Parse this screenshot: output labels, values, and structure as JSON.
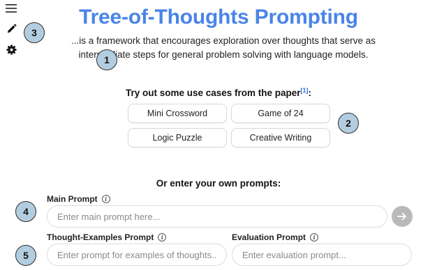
{
  "sidebar": {
    "icons": [
      "menu-icon",
      "pencil-icon",
      "gear-icon"
    ]
  },
  "header": {
    "title": "Tree-of-Thoughts Prompting",
    "subtitle": "...is a framework that encourages exploration over thoughts that serve as intermediate steps for general problem solving with language models."
  },
  "use_cases": {
    "heading": "Try out some use cases from the paper",
    "reference": "[1]",
    "heading_suffix": ":",
    "buttons": [
      "Mini Crossword",
      "Game of 24",
      "Logic Puzzle",
      "Creative Writing"
    ]
  },
  "prompts": {
    "heading": "Or enter your own prompts:",
    "main": {
      "label": "Main Prompt",
      "placeholder": "Enter main prompt here..."
    },
    "thought_examples": {
      "label": "Thought-Examples Prompt",
      "placeholder": "Enter prompt for examples of thoughts..."
    },
    "evaluation": {
      "label": "Evaluation Prompt",
      "placeholder": "Enter evaluation prompt..."
    },
    "info_glyph": "i"
  },
  "markers": [
    "1",
    "2",
    "3",
    "4",
    "5"
  ],
  "colors": {
    "title": "#4a84e8",
    "marker_fill": "#b3cde0",
    "send_button": "#b9b9b9"
  }
}
